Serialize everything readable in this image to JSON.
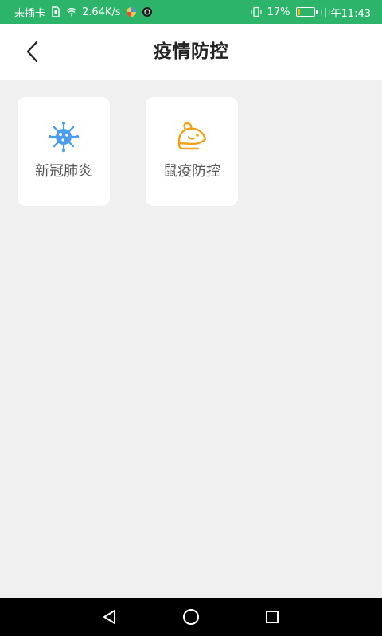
{
  "status_bar": {
    "carrier": "未插卡",
    "network_speed": "2.64K/s",
    "battery_percent": "17%",
    "time": "中午11:43",
    "battery_level": 0.17,
    "icons": [
      "sim-missing-icon",
      "wifi-icon",
      "app-notification-icon",
      "sync-icon",
      "vibrate-icon",
      "battery-icon"
    ]
  },
  "header": {
    "title": "疫情防控",
    "back_icon": "chevron-left-icon"
  },
  "modules": [
    {
      "label": "新冠肺炎",
      "icon": "virus-icon",
      "color": "#4a9df0"
    },
    {
      "label": "鼠疫防控",
      "icon": "rat-icon",
      "color": "#f0a21a"
    }
  ],
  "nav": {
    "icons": [
      "back-triangle-icon",
      "home-circle-icon",
      "recent-square-icon"
    ]
  },
  "colors": {
    "status_bar": "#2bb46a",
    "page_background": "#f0f0f0",
    "card_background": "#ffffff",
    "title_text": "#222222",
    "label_text": "#555555",
    "nav_bar": "#000000",
    "battery_fill": "#ffb300"
  }
}
